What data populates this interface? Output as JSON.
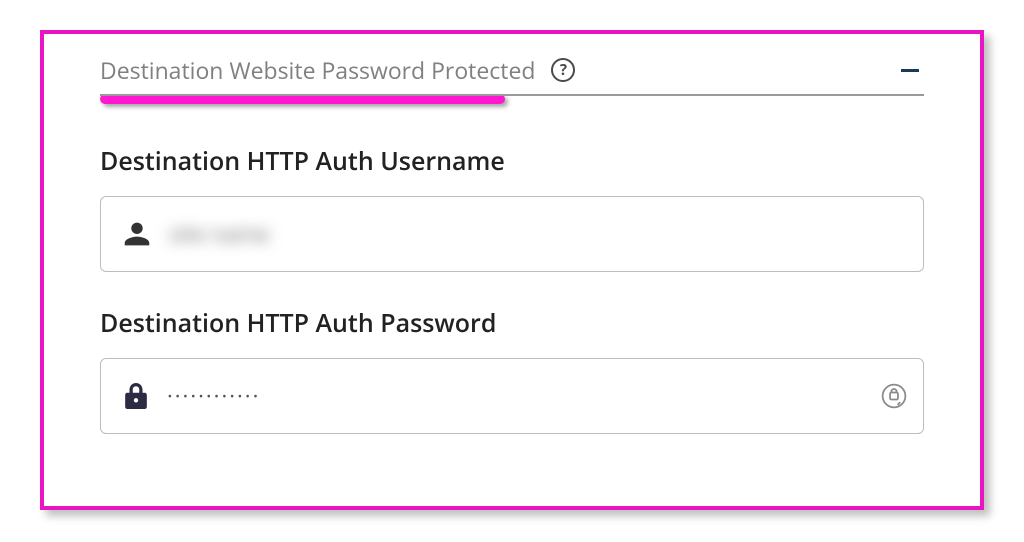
{
  "section": {
    "title": "Destination Website Password Protected",
    "help_label": "?",
    "collapse_label": "-"
  },
  "fields": {
    "username": {
      "label": "Destination HTTP Auth Username",
      "value": "site name"
    },
    "password": {
      "label": "Destination HTTP Auth Password",
      "value": "············"
    }
  },
  "colors": {
    "highlight_border": "#e815c2",
    "pink_underline": "#ff18d0",
    "title_text": "#808080",
    "divider": "#9a9a9a",
    "field_border": "#bdbdbd",
    "collapse_icon": "#1a3a5a"
  }
}
